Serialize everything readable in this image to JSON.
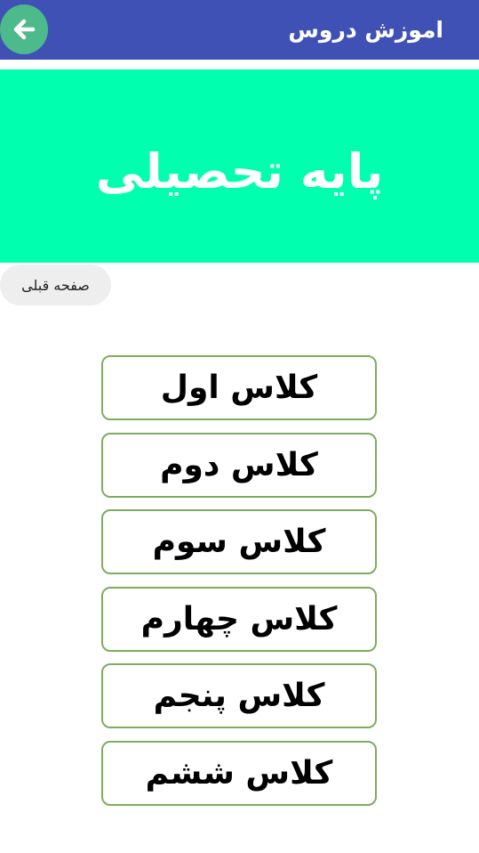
{
  "app_bar": {
    "title": "اموزش دروس",
    "back_icon": "arrow-left-icon",
    "colors": {
      "background": "#3f51b5",
      "back_button": "#4cba8a"
    }
  },
  "banner": {
    "title": "پایه تحصیلی",
    "color": "#00ffae"
  },
  "previous_page_label": "صفحه قبلی",
  "classes": [
    {
      "label": "کلاس اول"
    },
    {
      "label": "کلاس دوم"
    },
    {
      "label": "کلاس سوم"
    },
    {
      "label": "کلاس چهارم"
    },
    {
      "label": "کلاس پنجم"
    },
    {
      "label": "کلاس ششم"
    }
  ],
  "colors": {
    "button_border": "#7cad5f"
  }
}
